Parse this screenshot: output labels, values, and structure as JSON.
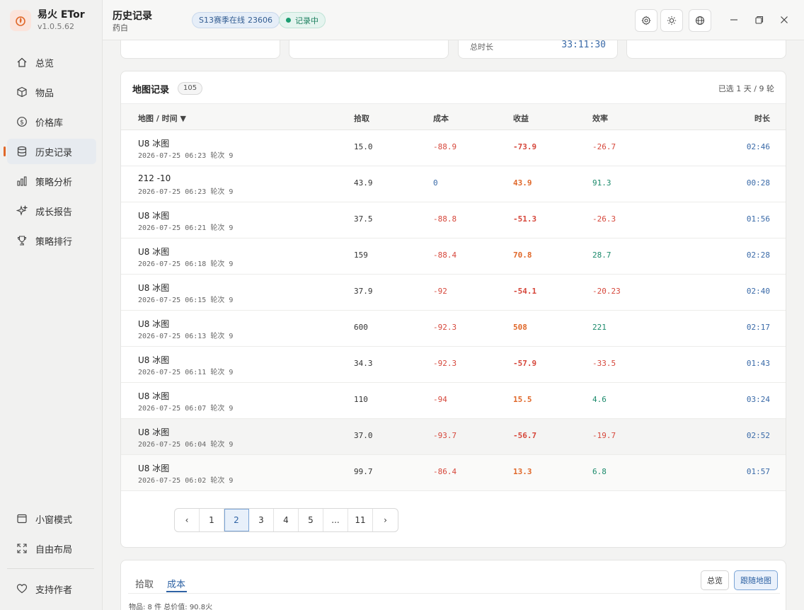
{
  "brand": {
    "title": "易火 ETor",
    "version": "v1.0.5.62"
  },
  "nav": {
    "items": [
      {
        "label": "总览",
        "icon": "home-icon"
      },
      {
        "label": "物品",
        "icon": "box-icon"
      },
      {
        "label": "价格库",
        "icon": "dollar-icon"
      },
      {
        "label": "历史记录",
        "icon": "database-icon",
        "active": true
      },
      {
        "label": "策略分析",
        "icon": "bar-chart-icon"
      },
      {
        "label": "成长报告",
        "icon": "sparkle-icon"
      },
      {
        "label": "策略排行",
        "icon": "trophy-icon"
      }
    ],
    "bottom": [
      {
        "label": "小窗模式",
        "icon": "window-icon"
      },
      {
        "label": "自由布局",
        "icon": "expand-icon"
      }
    ],
    "support": {
      "label": "支持作者",
      "icon": "heart-icon"
    }
  },
  "header": {
    "title": "历史记录",
    "subtitle": "药白",
    "season_badge": "S13赛季在线",
    "season_count": "23606",
    "record_badge": "记录中"
  },
  "stats": {
    "total_label": "总时长",
    "total_value": "33:11:30"
  },
  "map_records": {
    "title": "地图记录",
    "count": "105",
    "selection": "已选 1 天 / 9 轮",
    "columns": {
      "map": "地图 / 时间 ▼",
      "pick": "拾取",
      "cost": "成本",
      "gain": "收益",
      "eff": "效率",
      "dur": "时长"
    },
    "rows": [
      {
        "map": "U8 冰图",
        "time": "2026-07-25 06:23 轮次 9",
        "pick": "15.0",
        "cost": "-88.9",
        "gain": "-73.9",
        "eff": "-26.7",
        "dur": "02:46"
      },
      {
        "map": "212 -10",
        "time": "2026-07-25 06:23 轮次 9",
        "pick": "43.9",
        "cost": "0",
        "gain": "43.9",
        "eff": "91.3",
        "dur": "00:28"
      },
      {
        "map": "U8 冰图",
        "time": "2026-07-25 06:21 轮次 9",
        "pick": "37.5",
        "cost": "-88.8",
        "gain": "-51.3",
        "eff": "-26.3",
        "dur": "01:56"
      },
      {
        "map": "U8 冰图",
        "time": "2026-07-25 06:18 轮次 9",
        "pick": "159",
        "cost": "-88.4",
        "gain": "70.8",
        "eff": "28.7",
        "dur": "02:28"
      },
      {
        "map": "U8 冰图",
        "time": "2026-07-25 06:15 轮次 9",
        "pick": "37.9",
        "cost": "-92",
        "gain": "-54.1",
        "eff": "-20.23",
        "dur": "02:40"
      },
      {
        "map": "U8 冰图",
        "time": "2026-07-25 06:13 轮次 9",
        "pick": "600",
        "cost": "-92.3",
        "gain": "508",
        "eff": "221",
        "dur": "02:17"
      },
      {
        "map": "U8 冰图",
        "time": "2026-07-25 06:11 轮次 9",
        "pick": "34.3",
        "cost": "-92.3",
        "gain": "-57.9",
        "eff": "-33.5",
        "dur": "01:43"
      },
      {
        "map": "U8 冰图",
        "time": "2026-07-25 06:07 轮次 9",
        "pick": "110",
        "cost": "-94",
        "gain": "15.5",
        "eff": "4.6",
        "dur": "03:24"
      },
      {
        "map": "U8 冰图",
        "time": "2026-07-25 06:04 轮次 9",
        "pick": "37.0",
        "cost": "-93.7",
        "gain": "-56.7",
        "eff": "-19.7",
        "dur": "02:52"
      },
      {
        "map": "U8 冰图",
        "time": "2026-07-25 06:02 轮次 9",
        "pick": "99.7",
        "cost": "-86.4",
        "gain": "13.3",
        "eff": "6.8",
        "dur": "01:57"
      }
    ]
  },
  "pagination": {
    "prev": "‹",
    "pages": [
      "1",
      "2",
      "3",
      "4",
      "5",
      "...",
      "11"
    ],
    "current": "2",
    "next": "›"
  },
  "detail": {
    "tabs": [
      "拾取",
      "成本"
    ],
    "active_tab": "成本",
    "btn_overview": "总览",
    "btn_follow": "跟随地图",
    "summary": "物品: 8 件    总价值: 90.8火"
  },
  "colors": {
    "accent": "#e0682a",
    "blue": "#3a6aa8",
    "negative": "#d6473b",
    "positive": "#1b8a6b"
  }
}
